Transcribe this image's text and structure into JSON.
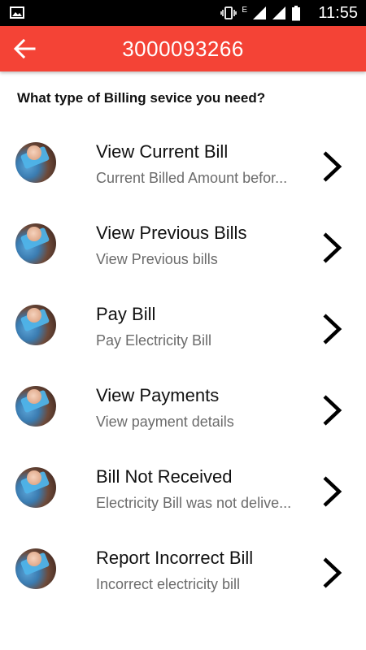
{
  "status_bar": {
    "time": "11:55",
    "network_label": "E"
  },
  "header": {
    "title": "3000093266",
    "accent_color": "#f44336"
  },
  "question": "What type of Billing sevice you need?",
  "items": [
    {
      "title": "View Current Bill",
      "subtitle": "Current Billed Amount befor..."
    },
    {
      "title": "View Previous Bills",
      "subtitle": "View Previous bills"
    },
    {
      "title": "Pay Bill",
      "subtitle": "Pay Electricity Bill"
    },
    {
      "title": "View Payments",
      "subtitle": "View payment details"
    },
    {
      "title": "Bill Not Received",
      "subtitle": "Electricity Bill was not delive..."
    },
    {
      "title": "Report Incorrect Bill",
      "subtitle": "Incorrect electricity bill"
    }
  ]
}
